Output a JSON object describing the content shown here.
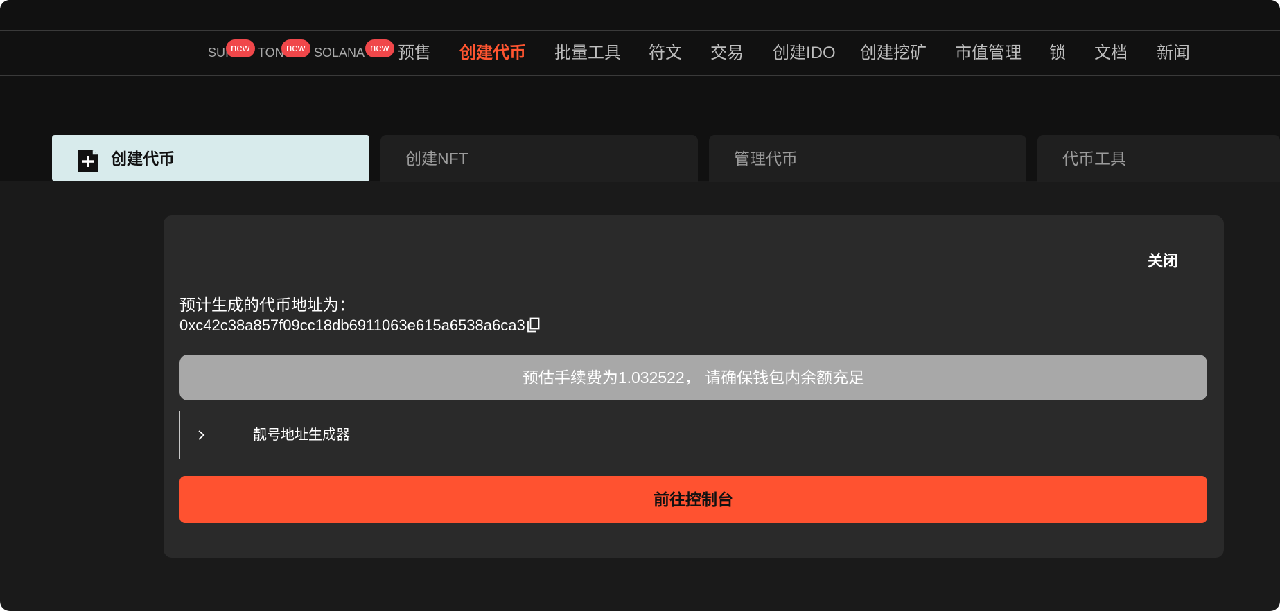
{
  "nav": {
    "items": [
      {
        "label": "SUI",
        "badge": "new"
      },
      {
        "label": "TON",
        "badge": "new"
      },
      {
        "label": "SOLANA",
        "badge": "new"
      },
      {
        "label": "预售"
      },
      {
        "label": "创建代币"
      },
      {
        "label": "批量工具"
      },
      {
        "label": "符文"
      },
      {
        "label": "交易"
      },
      {
        "label": "创建IDO"
      },
      {
        "label": "创建挖矿"
      },
      {
        "label": "市值管理"
      },
      {
        "label": "锁"
      },
      {
        "label": "文档"
      },
      {
        "label": "新闻"
      }
    ],
    "active_label": "创建代币"
  },
  "tabs": [
    {
      "label": "创建代币"
    },
    {
      "label": "创建NFT"
    },
    {
      "label": "管理代币"
    },
    {
      "label": "代币工具"
    }
  ],
  "panel": {
    "close_label": "关闭",
    "address_label": "预计生成的代币地址为：",
    "address_value": "0xc42c38a857f09cc18db6911063e615a6538a6ca3",
    "fee_notice": "预估手续费为1.032522， 请确保钱包内余额充足",
    "vanity_label": "靓号地址生成器",
    "console_button": "前往控制台"
  },
  "icons": {
    "tab_create": "file-plus-icon",
    "copy": "copy-icon",
    "expand": "chevron-right-icon"
  },
  "colors": {
    "accent": "#ff5230",
    "active_tab_bg": "#d8ebec",
    "badge": "#f0474a",
    "fee_bar": "#a8a8a8"
  }
}
